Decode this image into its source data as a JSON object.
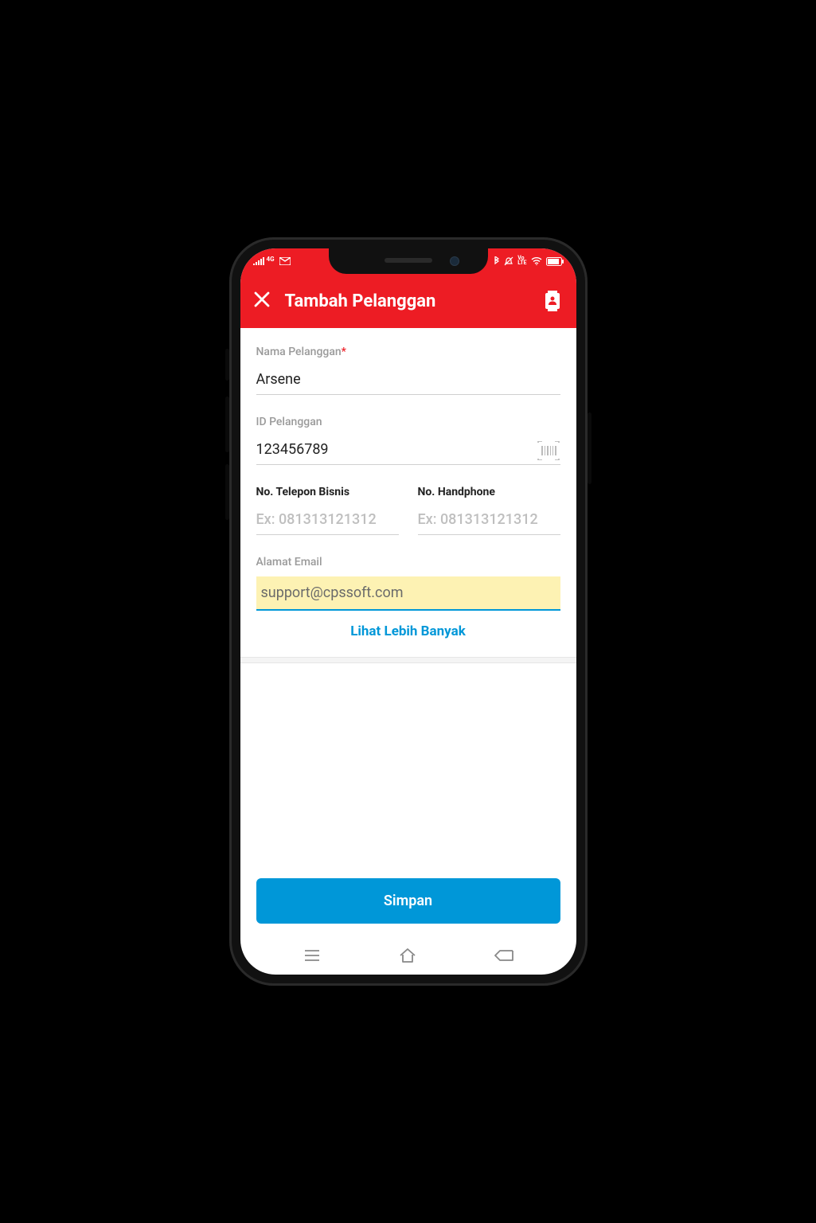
{
  "statusbar": {
    "network_type": "4G"
  },
  "appbar": {
    "title": "Tambah Pelanggan"
  },
  "form": {
    "name": {
      "label": "Nama Pelanggan",
      "required_mark": "*",
      "value": "Arsene"
    },
    "id": {
      "label": "ID Pelanggan",
      "value": "123456789"
    },
    "phone_business": {
      "label": "No. Telepon Bisnis",
      "placeholder": "Ex: 081313121312",
      "value": ""
    },
    "phone_mobile": {
      "label": "No. Handphone",
      "placeholder": "Ex: 081313121312",
      "value": ""
    },
    "email": {
      "label": "Alamat Email",
      "value": "support@cpssoft.com"
    },
    "more_link": "Lihat Lebih Banyak"
  },
  "footer": {
    "save_label": "Simpan"
  }
}
